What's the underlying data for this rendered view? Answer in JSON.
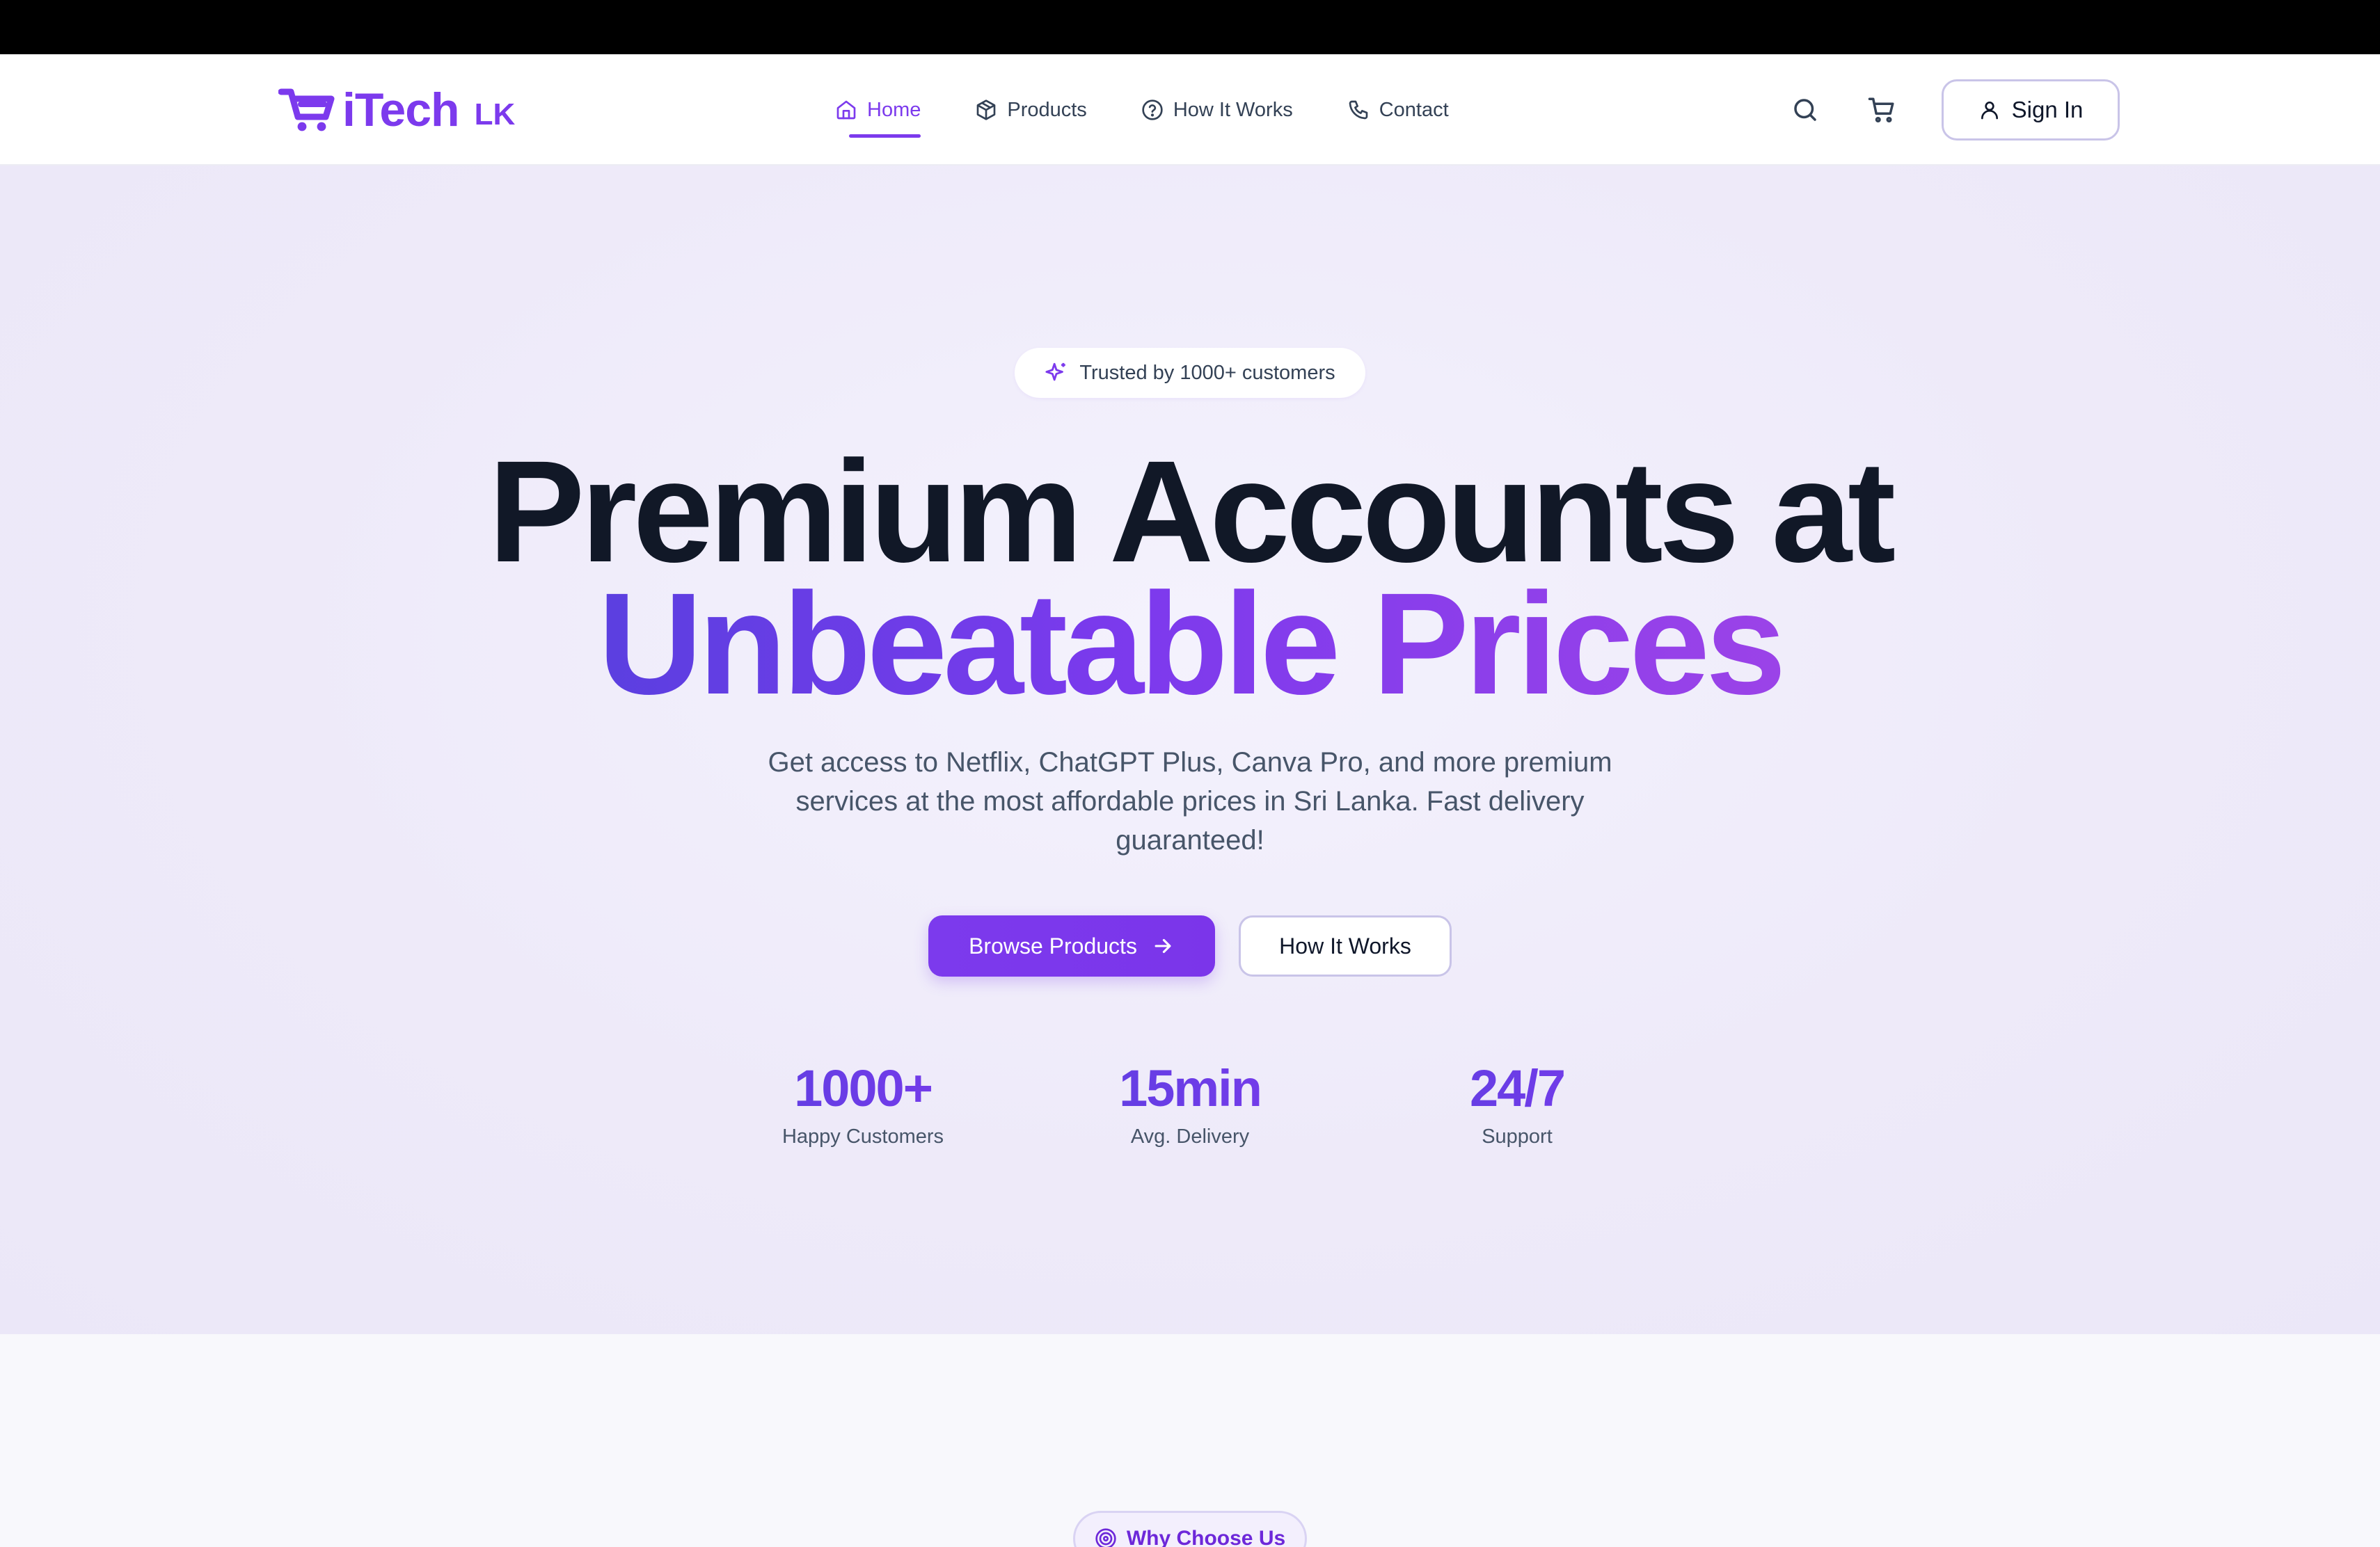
{
  "brand": {
    "name": "iTech",
    "suffix": "LK"
  },
  "nav": {
    "items": [
      {
        "label": "Home",
        "icon": "home-icon",
        "active": true
      },
      {
        "label": "Products",
        "icon": "box-icon",
        "active": false
      },
      {
        "label": "How It Works",
        "icon": "help-circle-icon",
        "active": false
      },
      {
        "label": "Contact",
        "icon": "phone-icon",
        "active": false
      }
    ],
    "sign_in": "Sign In"
  },
  "hero": {
    "badge": "Trusted by 1000+ customers",
    "headline_line1": "Premium Accounts at",
    "headline_line2": "Unbeatable Prices",
    "subtitle": "Get access to Netflix, ChatGPT Plus, Canva Pro, and more premium services at the most affordable prices in Sri Lanka. Fast delivery guaranteed!",
    "primary_cta": "Browse Products",
    "secondary_cta": "How It Works",
    "stats": [
      {
        "value": "1000+",
        "label": "Happy Customers"
      },
      {
        "value": "15min",
        "label": "Avg. Delivery"
      },
      {
        "value": "24/7",
        "label": "Support"
      }
    ]
  },
  "section2": {
    "badge": "Why Choose Us"
  },
  "colors": {
    "accent": "#7c3aed",
    "text": "#111827",
    "muted": "#475569"
  }
}
